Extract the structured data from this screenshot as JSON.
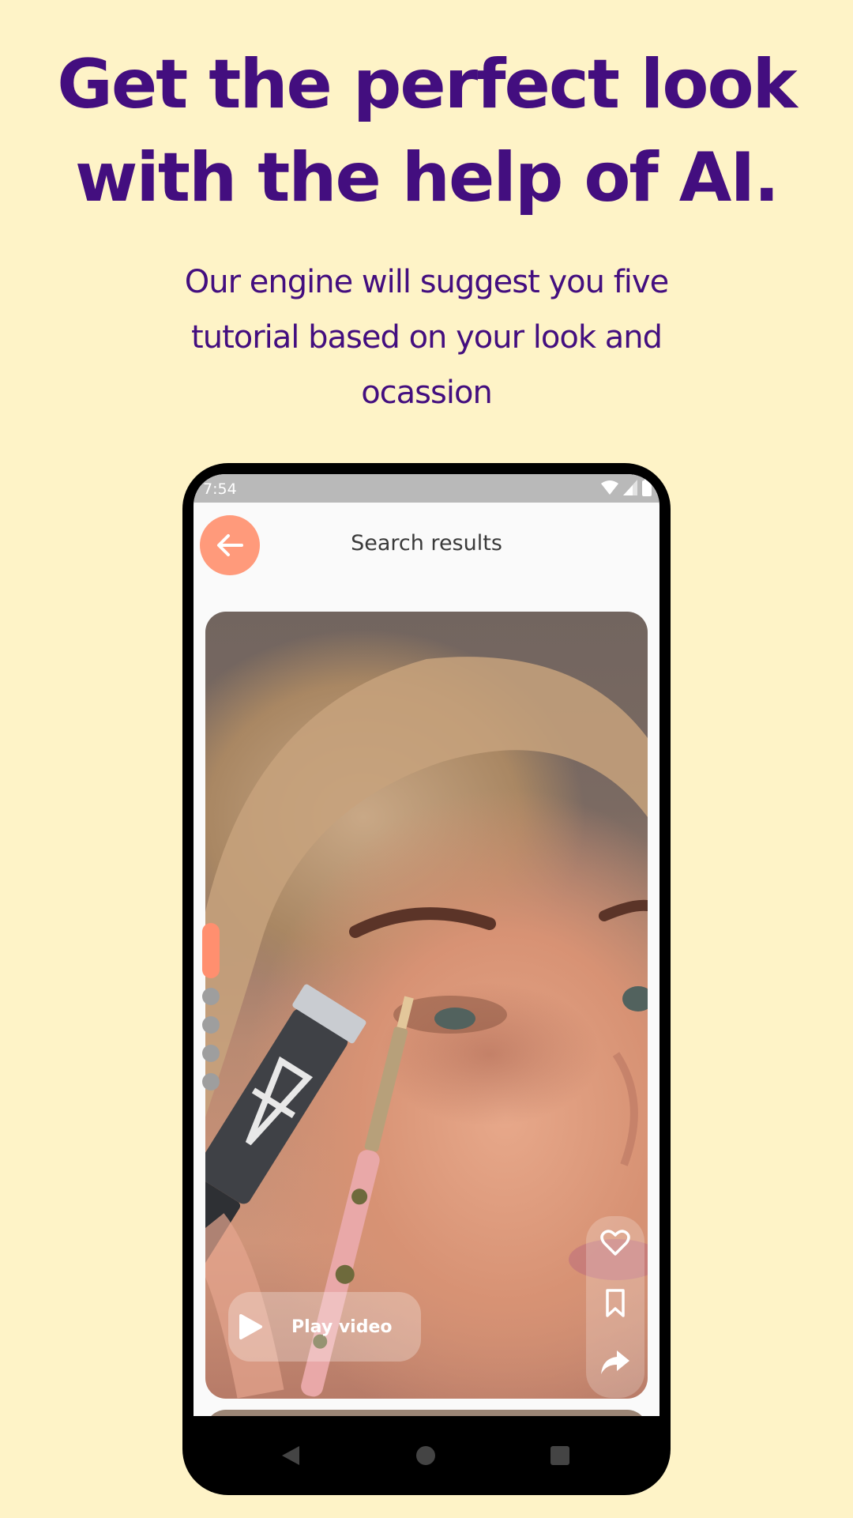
{
  "headline": {
    "line1": "Get the perfect look",
    "line2": "with the help of AI."
  },
  "subline": {
    "line1": "Our engine will suggest you five",
    "line2": "tutorial based on your look and",
    "line3": "ocassion"
  },
  "colors": {
    "background": "#FEF3C7",
    "text": "#430E7F",
    "accent": "#FF9A7B"
  },
  "device": {
    "status": {
      "time": "7:54",
      "icons": [
        "wifi-icon",
        "signal-icon",
        "battery-icon"
      ]
    },
    "app_bar": {
      "title": "Search results",
      "back_icon": "arrow-left-icon"
    },
    "video": {
      "play_label": "Play video",
      "actions": [
        "heart-icon",
        "bookmark-icon",
        "share-icon"
      ]
    },
    "pager": {
      "count": 5,
      "active_index": 0
    },
    "nav_bar": [
      "back-triangle-icon",
      "home-circle-icon",
      "recents-square-icon"
    ]
  }
}
